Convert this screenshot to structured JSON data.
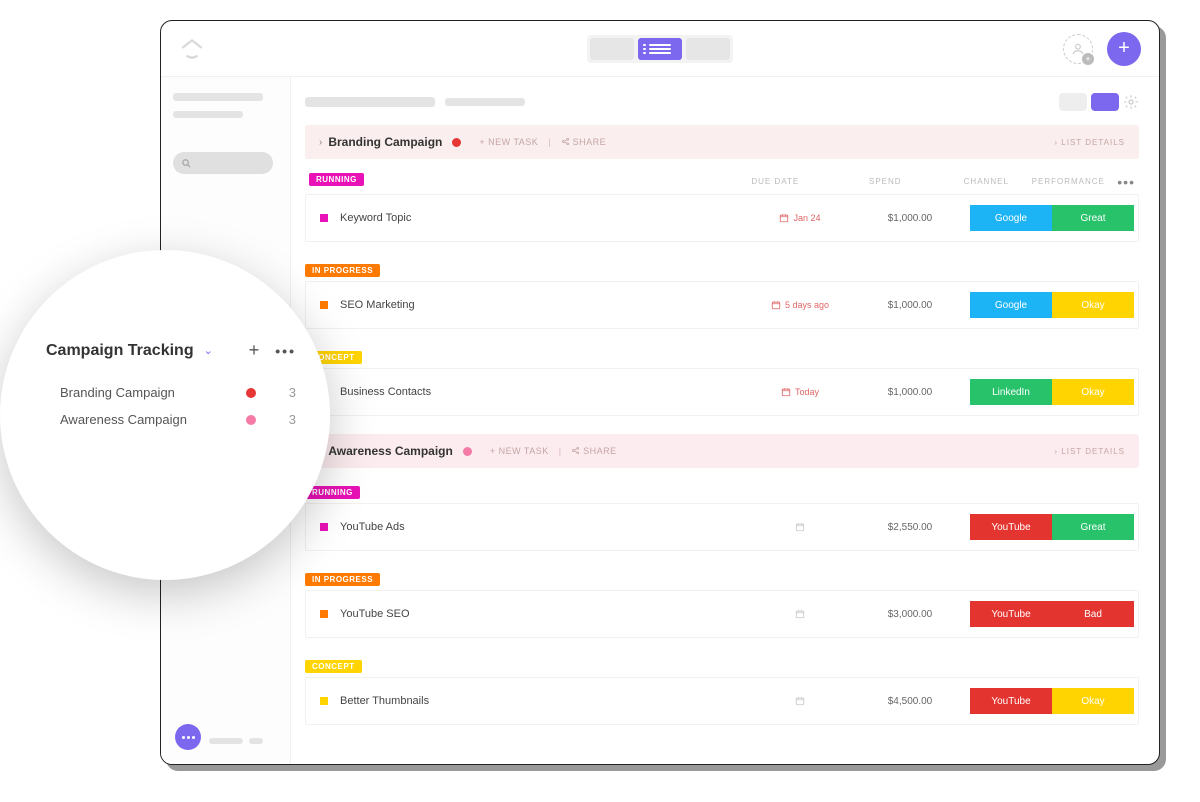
{
  "sidebar_popup": {
    "space_title": "Campaign Tracking",
    "items": [
      {
        "label": "Branding Campaign",
        "dot_color": "red",
        "count": "3"
      },
      {
        "label": "Awareness Campaign",
        "dot_color": "pink",
        "count": "3"
      }
    ]
  },
  "columns": {
    "due": "DUE DATE",
    "spend": "SPEND",
    "channel": "CHANNEL",
    "performance": "PERFORMANCE"
  },
  "actions": {
    "new_task": "+ NEW TASK",
    "share": "SHARE",
    "list_details": "LIST DETAILS"
  },
  "status_labels": {
    "running": "RUNNING",
    "inprogress": "IN PROGRESS",
    "concept": "CONCEPT"
  },
  "campaigns": [
    {
      "title": "Branding Campaign",
      "dot": "red",
      "bar_class": "",
      "groups": [
        {
          "status": "running",
          "task": "Keyword Topic",
          "sq": "magenta",
          "due": "Jan 24",
          "due_class": "red",
          "spend": "$1,000.00",
          "channel": "Google",
          "channel_class": "google",
          "perf": "Great",
          "perf_class": "great"
        },
        {
          "status": "inprogress",
          "task": "SEO Marketing",
          "sq": "orange",
          "due": "5 days ago",
          "due_class": "red",
          "spend": "$1,000.00",
          "channel": "Google",
          "channel_class": "google",
          "perf": "Okay",
          "perf_class": "okay"
        },
        {
          "status": "concept",
          "task": "Business Contacts",
          "sq": "yellow",
          "due": "Today",
          "due_class": "red",
          "spend": "$1,000.00",
          "channel": "LinkedIn",
          "channel_class": "linkedin",
          "perf": "Okay",
          "perf_class": "okay"
        }
      ]
    },
    {
      "title": "Awareness Campaign",
      "dot": "pink",
      "bar_class": "pink",
      "groups": [
        {
          "status": "running",
          "task": "YouTube Ads",
          "sq": "magenta",
          "due": "",
          "due_class": "grey",
          "spend": "$2,550.00",
          "channel": "YouTube",
          "channel_class": "youtube",
          "perf": "Great",
          "perf_class": "great"
        },
        {
          "status": "inprogress",
          "task": "YouTube SEO",
          "sq": "orange",
          "due": "",
          "due_class": "grey",
          "spend": "$3,000.00",
          "channel": "YouTube",
          "channel_class": "youtube",
          "perf": "Bad",
          "perf_class": "bad"
        },
        {
          "status": "concept",
          "task": "Better Thumbnails",
          "sq": "yellow",
          "due": "",
          "due_class": "grey",
          "spend": "$4,500.00",
          "channel": "YouTube",
          "channel_class": "youtube",
          "perf": "Okay",
          "perf_class": "okay"
        }
      ]
    }
  ]
}
